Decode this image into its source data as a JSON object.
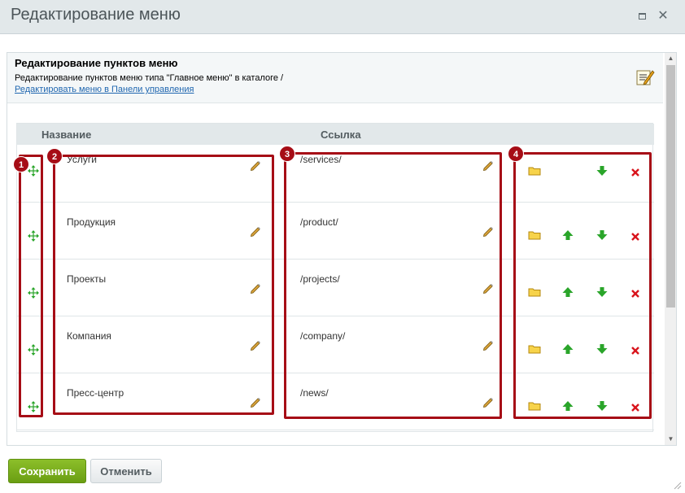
{
  "window": {
    "title": "Редактирование меню",
    "maximize_icon": "maximize-icon",
    "close_icon": "close-icon"
  },
  "header": {
    "title": "Редактирование пунктов меню",
    "description": "Редактирование пунктов меню типа \"Главное меню\" в каталоге /",
    "link": "Редактировать меню в Панели управления",
    "icon": "edit-menu-icon"
  },
  "table": {
    "col_name": "Название",
    "col_link": "Ссылка",
    "rows": [
      {
        "name": "Услуги",
        "link": "/services/",
        "has_up": false
      },
      {
        "name": "Продукция",
        "link": "/product/",
        "has_up": true
      },
      {
        "name": "Проекты",
        "link": "/projects/",
        "has_up": true
      },
      {
        "name": "Компания",
        "link": "/company/",
        "has_up": true
      },
      {
        "name": "Пресс-центр",
        "link": "/news/",
        "has_up": true
      }
    ]
  },
  "callouts": {
    "one": "1",
    "two": "2",
    "three": "3",
    "four": "4"
  },
  "footer": {
    "save_label": "Сохранить",
    "cancel_label": "Отменить"
  },
  "colors": {
    "accent_red": "#a60d16",
    "save_green": "#7aae1c",
    "link_blue": "#2067b0"
  }
}
